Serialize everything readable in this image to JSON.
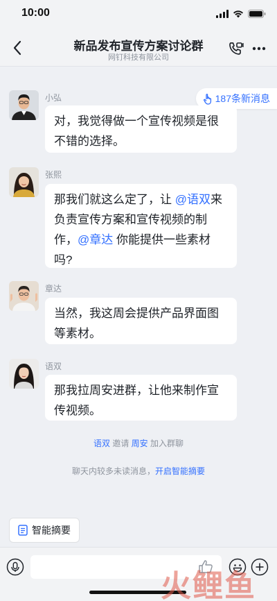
{
  "status_bar": {
    "time": "10:00"
  },
  "header": {
    "title": "新品发布宣传方案讨论群",
    "subtitle": "网钉科技有限公司"
  },
  "new_messages_badge": "187条新消息",
  "messages": [
    {
      "sender": "小弘",
      "parts": [
        "对，我觉得做一个宣传视频是很不错的选择。"
      ]
    },
    {
      "sender": "张熙",
      "parts": [
        "那我们就这么定了，让 ",
        "@语双",
        "来负责宣传方案和宣传视频的制作，",
        "@章达",
        " 你能提供一些素材吗?"
      ]
    },
    {
      "sender": "章达",
      "parts": [
        "当然，我这周会提供产品界面图等素材。"
      ]
    },
    {
      "sender": "语双",
      "parts": [
        "那我拉周安进群，让他来制作宣传视频。"
      ]
    }
  ],
  "system": {
    "invite": {
      "inviter": "语双",
      "verb": "邀请",
      "invitee": "周安",
      "action": "加入群聊"
    },
    "unread_hint": "聊天内较多未读消息，",
    "summary_link": "开启智能摘要"
  },
  "summary_button": "智能摘要",
  "watermark": "火鲤鱼",
  "colors": {
    "accent": "#3370ff",
    "background": "#eef0f4",
    "bubble": "#ffffff"
  }
}
